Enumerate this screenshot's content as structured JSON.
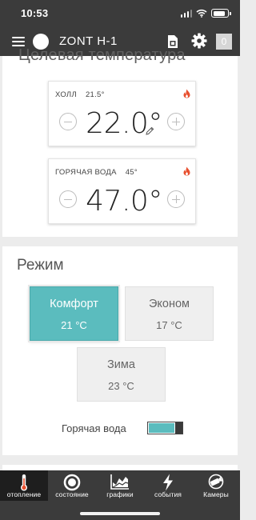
{
  "status_bar": {
    "time": "10:53"
  },
  "header": {
    "device_name": "ZONT H-1",
    "notifications_count": "0"
  },
  "target_temperature": {
    "title": "Целевая температура",
    "zones": [
      {
        "name": "ХОЛЛ",
        "current": "21.5°",
        "target": "22.0°"
      },
      {
        "name": "ГОРЯЧАЯ ВОДА",
        "current": "45°",
        "target": "47.0°"
      }
    ]
  },
  "mode": {
    "title": "Режим",
    "options": [
      {
        "name": "Комфорт",
        "temp": "21 °C",
        "active": true
      },
      {
        "name": "Эконом",
        "temp": "17 °C",
        "active": false
      },
      {
        "name": "Зима",
        "temp": "23 °C",
        "active": false
      }
    ],
    "hot_water": {
      "label": "Горячая вода",
      "enabled": true
    }
  },
  "tabs": [
    {
      "label": "отопление",
      "icon": "thermometer-icon",
      "active": true
    },
    {
      "label": "состояние",
      "icon": "status-circle-icon",
      "active": false
    },
    {
      "label": "графики",
      "icon": "chart-icon",
      "active": false
    },
    {
      "label": "события",
      "icon": "lightning-icon",
      "active": false
    },
    {
      "label": "Камеры",
      "icon": "camera-icon",
      "active": false
    }
  ],
  "colors": {
    "accent": "#5bbcbe",
    "bar": "#3b3b3b",
    "active_tab": "#1e1e1e",
    "flame": "#e8502f"
  }
}
